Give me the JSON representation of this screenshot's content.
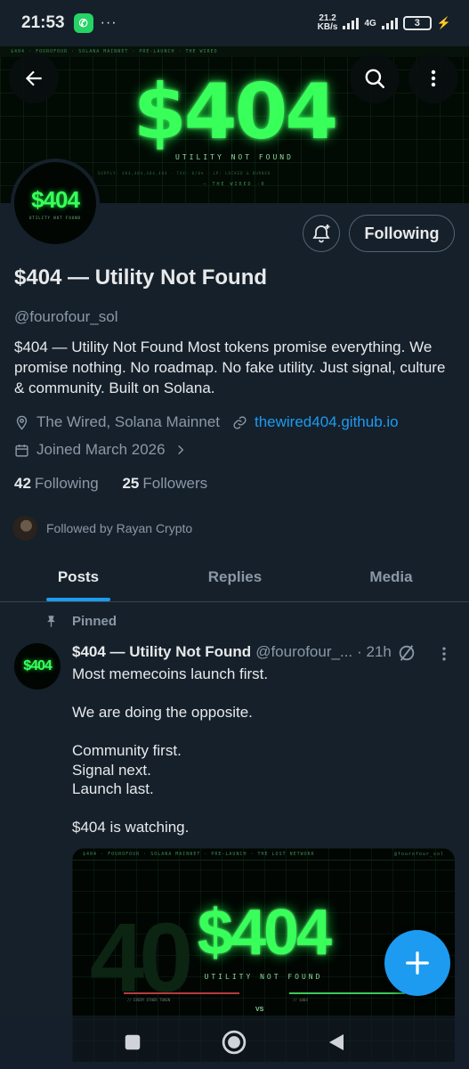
{
  "status_bar": {
    "time": "21:53",
    "net_speed_value": "21.2",
    "net_speed_unit": "KB/s",
    "network_type": "4G",
    "battery": "3"
  },
  "banner": {
    "title": "$404",
    "subtitle": "UTILITY NOT FOUND",
    "top_line": "$404 · FOUROFOUR · SOLANA MAINNET · PRE-LAUNCH · THE WIRED",
    "meta_line": "SUPPLY: 404,404,404,404  ·  TAX: 0/0%  ·  LP: LOCKED & BURNED",
    "footer_line": "— THE WIRED ·0"
  },
  "profile": {
    "avatar_logo": "$404",
    "avatar_tag": "UTILITY NOT FOUND",
    "display_name": "$404 — Utility Not Found",
    "handle": "@fourofour_sol",
    "bio": "$404 — Utility Not Found  Most tokens promise everything. We promise nothing.  No roadmap. No fake utility. Just signal, culture & community.  Built on Solana.",
    "location": "The Wired, Solana Mainnet",
    "website": "thewired404.github.io",
    "joined": "Joined March 2026",
    "following_count": "42",
    "following_label": "Following",
    "followers_count": "25",
    "followers_label": "Followers",
    "followed_by": "Followed by Rayan Crypto",
    "follow_button": "Following"
  },
  "tabs": [
    "Posts",
    "Replies",
    "Media"
  ],
  "post": {
    "pinned_label": "Pinned",
    "avatar_logo": "$404",
    "author_name": "$404 — Utility Not Found",
    "author_handle": "@fourofour_...",
    "time": "· 21h",
    "lines": [
      "Most memecoins launch first.",
      "",
      "We are doing the opposite.",
      "",
      "Community first.",
      "Signal next.",
      "Launch last.",
      "",
      "$404 is watching."
    ],
    "image": {
      "title": "$404",
      "subtitle": "UTILITY NOT FOUND",
      "ghost": "40",
      "top_line": "$404 · FOUROFOUR · SOLANA MAINNET · PRE-LAUNCH · THE LOST NETWORK",
      "top_right": "@fourofour_sol",
      "vs": "VS",
      "left_box": "// EVERY OTHER TOKEN",
      "right_box": "// $404"
    }
  },
  "colors": {
    "background": "#15202b",
    "accent": "#1d9bf0",
    "neon_green": "#39ff5a",
    "secondary_text": "#8b98a5"
  }
}
